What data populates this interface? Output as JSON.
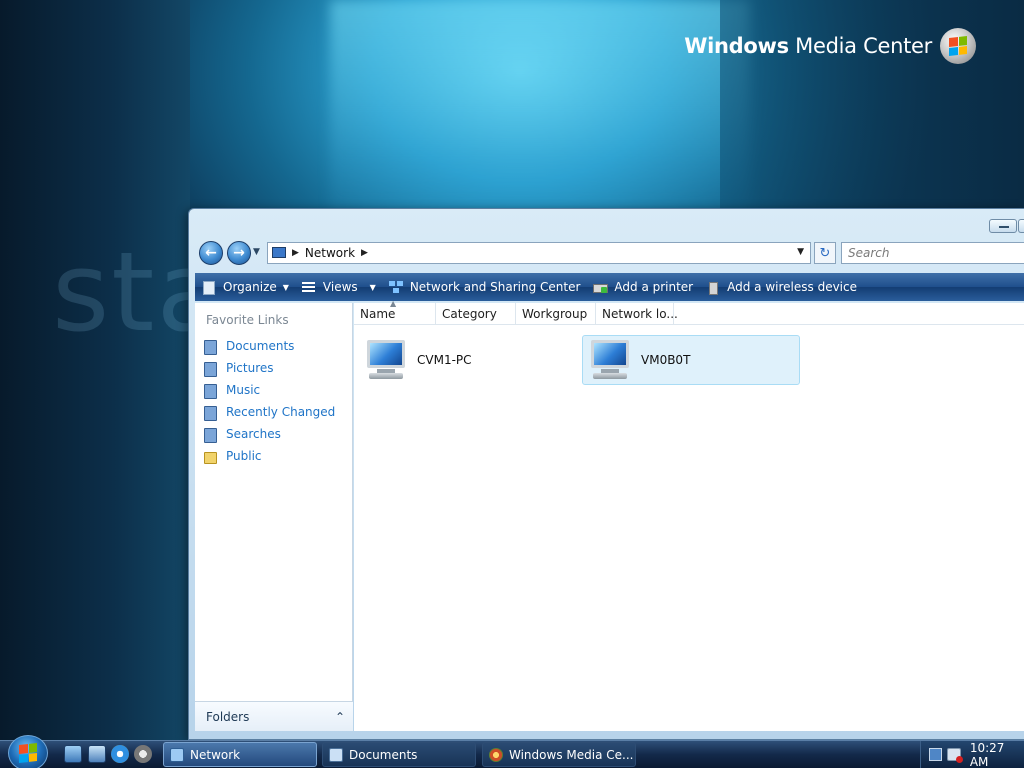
{
  "desktop": {
    "brand_bold": "Windows",
    "brand_regular": "Media Center",
    "ghost_word": "sta"
  },
  "window": {
    "address_location": "Network",
    "search_placeholder": "Search",
    "toolbar": {
      "organize": "Organize",
      "views": "Views",
      "network_sharing": "Network and Sharing Center",
      "add_printer": "Add a printer",
      "add_wireless": "Add a wireless device"
    },
    "nav": {
      "heading": "Favorite Links",
      "items": [
        {
          "label": "Documents",
          "icon": "documents-icon"
        },
        {
          "label": "Pictures",
          "icon": "pictures-icon"
        },
        {
          "label": "Music",
          "icon": "music-icon"
        },
        {
          "label": "Recently Changed",
          "icon": "recently-changed-icon"
        },
        {
          "label": "Searches",
          "icon": "searches-icon"
        },
        {
          "label": "Public",
          "icon": "folder-icon"
        }
      ],
      "folders_label": "Folders"
    },
    "columns": [
      "Name",
      "Category",
      "Workgroup",
      "Network lo..."
    ],
    "items": [
      {
        "name": "CVM1-PC",
        "selected": false
      },
      {
        "name": "VM0B0T",
        "selected": true
      }
    ]
  },
  "taskbar": {
    "tasks": [
      {
        "label": "Network",
        "active": true
      },
      {
        "label": "Documents",
        "active": false
      },
      {
        "label": "Windows Media Ce...",
        "active": false
      }
    ],
    "clock": "10:27 AM"
  }
}
